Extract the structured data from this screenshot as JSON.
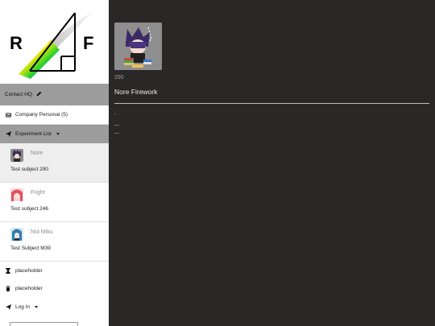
{
  "logo": {
    "letter_left": "R",
    "letter_right": "F"
  },
  "sidebar": {
    "contact": {
      "label": "Contact HQ",
      "icon": "pencil-icon"
    },
    "company": {
      "label": "Company Personal (5)",
      "icon": "inbox-icon"
    },
    "experiment": {
      "label": "Experiment List",
      "icon": "send-icon"
    },
    "subjects": [
      {
        "name": "Nore",
        "desc": "Test subject 290"
      },
      {
        "name": "Fright",
        "desc": "Test subject 246"
      },
      {
        "name": "Not Miku",
        "desc": "Test Subject M39"
      }
    ],
    "placeholder1": {
      "label": "placeholder",
      "icon": "hourglass-icon"
    },
    "placeholder2": {
      "label": "placeholder",
      "icon": "trash-icon"
    },
    "login": {
      "label": "Log In",
      "icon": "send-icon"
    }
  },
  "main": {
    "number": "290",
    "name": "Nore Firework",
    "marks": [
      "-",
      "—",
      "—"
    ]
  },
  "colors": {
    "main_bg": "#2a2826",
    "sidebar_active": "#9c9c9c",
    "subject_selected": "#eeeeee"
  }
}
